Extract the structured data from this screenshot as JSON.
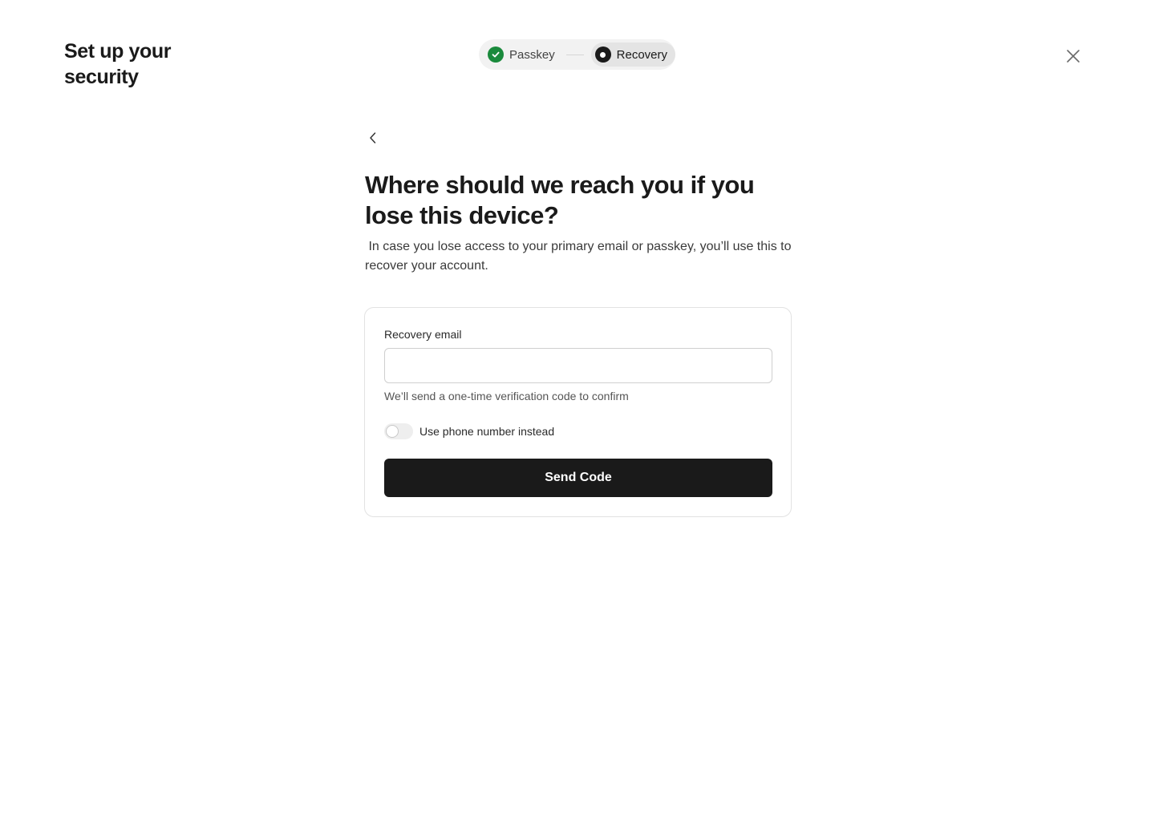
{
  "header": {
    "title": "Set up your security"
  },
  "stepper": {
    "steps": [
      {
        "label": "Passkey",
        "state": "completed",
        "icon": "check-icon"
      },
      {
        "label": "Recovery",
        "state": "current",
        "icon": "dot-icon"
      }
    ]
  },
  "main": {
    "heading": "Where should we reach you if you lose this device?",
    "subtext": " In case you lose access to your primary email or passkey, you’ll use this to recover your account."
  },
  "form": {
    "email_label": "Recovery email",
    "email_value": "",
    "email_placeholder": "",
    "helper_text": "We’ll send a one-time verification code to confirm",
    "toggle_label": "Use phone number instead",
    "toggle_on": false,
    "submit_label": "Send Code"
  },
  "colors": {
    "success": "#1a8a3c",
    "primary": "#1a1a1a",
    "background": "#ffffff"
  }
}
